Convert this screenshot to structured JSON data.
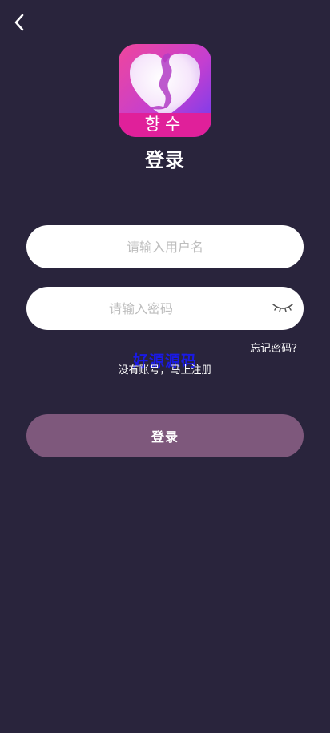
{
  "header": {
    "back_icon": "chevron-left-icon"
  },
  "logo": {
    "text": "향수",
    "gradient": [
      "#e23ea8",
      "#7b3cf0"
    ]
  },
  "title": "登录",
  "form": {
    "username_placeholder": "请输入用户名",
    "password_placeholder": "请输入密码",
    "eye_icon": "eye-closed-icon",
    "forgot_password": "忘记密码?",
    "watermark": "好源源码",
    "register": "没有账号，马上注册",
    "login_button": "登录"
  },
  "colors": {
    "background": "#29243c",
    "login_button": "#7e587c",
    "watermark": "#1a1ae6"
  }
}
